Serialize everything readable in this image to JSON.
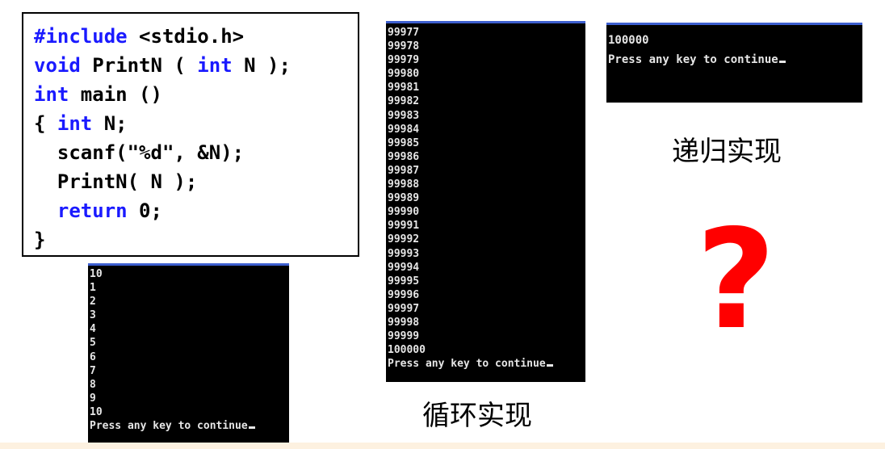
{
  "code": {
    "line1_kw": "#include",
    "line1_rest": " <stdio.h>",
    "line2_kw": "void",
    "line2_rest": " PrintN ( ",
    "line2_kw2": "int",
    "line2_rest2": " N );",
    "line3_kw": "int",
    "line3_rest": " main ()",
    "line4_pre": "{ ",
    "line4_kw": "int",
    "line4_rest": " N;",
    "line5": "  scanf(\"%d\", &N);",
    "line6": "  PrintN( N );",
    "line7_pre": "  ",
    "line7_kw": "return",
    "line7_rest": " 0;",
    "line8": "}"
  },
  "console_small": {
    "lines": [
      "10",
      "1",
      "2",
      "3",
      "4",
      "5",
      "6",
      "7",
      "8",
      "9",
      "10"
    ],
    "prompt": "Press any key to continue"
  },
  "console_loop": {
    "lines": [
      "99977",
      "99978",
      "99979",
      "99980",
      "99981",
      "99982",
      "99983",
      "99984",
      "99985",
      "99986",
      "99987",
      "99988",
      "99989",
      "99990",
      "99991",
      "99992",
      "99993",
      "99994",
      "99995",
      "99996",
      "99997",
      "99998",
      "99999",
      "100000"
    ],
    "prompt": "Press any key to continue"
  },
  "console_recursive": {
    "lines": [
      "100000"
    ],
    "prompt": "Press any key to continue"
  },
  "captions": {
    "loop": "循环实现",
    "recursive": "递归实现",
    "question_mark": "?"
  },
  "colors": {
    "keyword": "#1a1aff",
    "console_bg": "#000000",
    "question": "#ff0000"
  }
}
